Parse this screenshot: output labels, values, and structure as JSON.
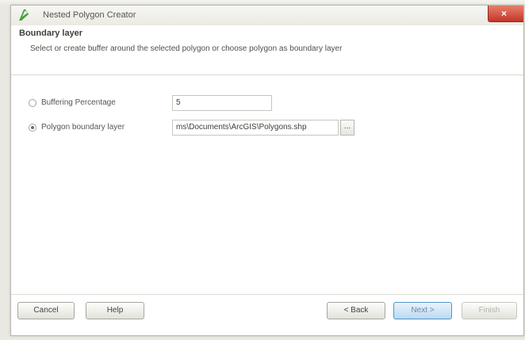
{
  "window": {
    "title": "Nested Polygon Creator",
    "close_label": "×"
  },
  "page": {
    "title": "Boundary layer",
    "description": "Select or create buffer around the selected polygon or choose polygon as boundary layer"
  },
  "options": {
    "buffer": {
      "label": "Buffering Percentage",
      "value": "5",
      "selected": false
    },
    "boundary": {
      "label": "Polygon boundary layer",
      "value": "ms\\Documents\\ArcGIS\\Polygons.shp",
      "browse_label": "...",
      "selected": true
    }
  },
  "footer": {
    "cancel_label": "Cancel",
    "help_label": "Help",
    "back_label": "< Back",
    "next_label": "Next >",
    "finish_label": "Finish"
  },
  "colors": {
    "close_button": "#c6342a",
    "default_button_border": "#4f93c9"
  }
}
